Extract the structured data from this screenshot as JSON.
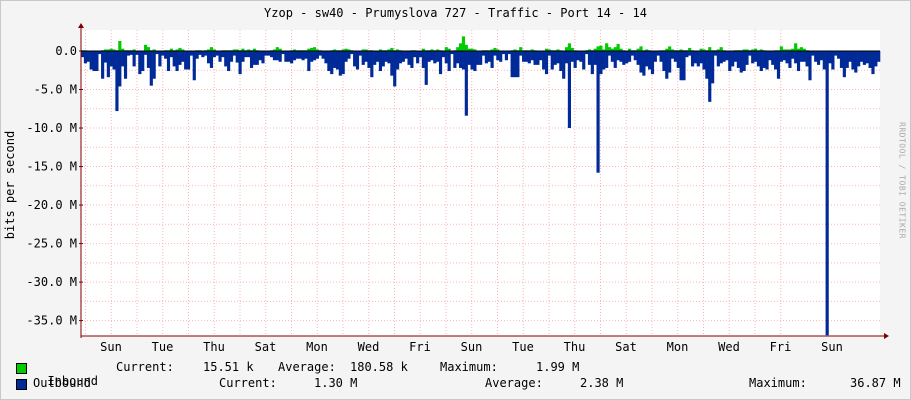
{
  "title": "Yzop - sw40 - Prumyslova 727 - Traffic - Port 14 - 14",
  "vendor_text": "RRDTOOL / TOBI OETIKER",
  "colors": {
    "inbound": "#00cc00",
    "outbound": "#002a97",
    "grid": "#ffb4b4",
    "axis": "#800000",
    "background": "#ffffff"
  },
  "chart_data": {
    "type": "area",
    "ylabel": "bits per second",
    "ylim": [
      -37000000,
      2500000
    ],
    "yticks": [
      0,
      -5000000,
      -10000000,
      -15000000,
      -20000000,
      -25000000,
      -30000000,
      -35000000
    ],
    "ytick_labels": [
      "0.0",
      "-5.0 M",
      "-10.0 M",
      "-15.0 M",
      "-20.0 M",
      "-25.0 M",
      "-30.0 M",
      "-35.0 M"
    ],
    "xtick_labels": [
      "Sun",
      "Tue",
      "Thu",
      "Sat",
      "Mon",
      "Wed",
      "Fri",
      "Sun",
      "Tue",
      "Thu",
      "Sat",
      "Mon",
      "Wed",
      "Fri",
      "Sun"
    ],
    "grid": true,
    "series": [
      {
        "name": "Inbound",
        "values_mbps": [
          0.1,
          0.1,
          0,
          0,
          0,
          0,
          0,
          0.1,
          0.2,
          0.2,
          0.3,
          0.2,
          0.1,
          1.3,
          0.3,
          0.1,
          0.1,
          0.1,
          0.2,
          0,
          0,
          0,
          0.8,
          0.5,
          0.1,
          0.2,
          0,
          0,
          0,
          0.1,
          0.1,
          0.3,
          0.1,
          0.2,
          0.4,
          0.2,
          0,
          0,
          0,
          0,
          0.1,
          0.1,
          0,
          0.1,
          0.2,
          0.5,
          0.2,
          0,
          0,
          0.1,
          0.1,
          0.1,
          0.1,
          0.2,
          0.2,
          0.1,
          0.3,
          0.1,
          0.2,
          0.1,
          0.3,
          0.1,
          0,
          0,
          0,
          0,
          0.1,
          0.2,
          0.5,
          0.3,
          0,
          0,
          0,
          0.1,
          0.2,
          0.1,
          0.1,
          0.1,
          0.1,
          0.3,
          0.4,
          0.5,
          0.2,
          0.1,
          0,
          0,
          0,
          0.1,
          0.2,
          0.1,
          0.1,
          0.2,
          0.3,
          0.2,
          0.1,
          0,
          0,
          0,
          0.2,
          0.2,
          0.1,
          0.1,
          0,
          0,
          0.2,
          0.1,
          0.1,
          0.2,
          0.4,
          0.1,
          0.2,
          0.1,
          0,
          0,
          0,
          0.1,
          0.1,
          0,
          0,
          0.3,
          0.1,
          0.1,
          0.2,
          0.1,
          0.2,
          0.1,
          0,
          0.5,
          0.3,
          0,
          0.1,
          0.5,
          1.0,
          1.9,
          0.8,
          0.3,
          0.3,
          0.2,
          0,
          0,
          0.1,
          0.1,
          0.1,
          0.2,
          0.4,
          0.2,
          0,
          0,
          0,
          0,
          0.1,
          0.2,
          0.1,
          0.5,
          0.1,
          0.1,
          0.1,
          0.2,
          0.1,
          0,
          0,
          0,
          0.3,
          0.2,
          0.1,
          0.1,
          0.2,
          0.1,
          0,
          0.5,
          1.0,
          0.4,
          0.1,
          0,
          0,
          0,
          0.1,
          0.2,
          0.1,
          0.3,
          0.6,
          0.7,
          0.2,
          1.0,
          0.5,
          0.3,
          0.5,
          0.9,
          0.3,
          0.1,
          0,
          0.3,
          0.1,
          0.1,
          0.3,
          0.6,
          0.1,
          0.2,
          0.1,
          0,
          0,
          0,
          0.1,
          0.1,
          0.3,
          0.6,
          0.2,
          0.1,
          0.1,
          0.2,
          0.1,
          0.1,
          0.4,
          0.1,
          0,
          0,
          0.3,
          0.2,
          0.1,
          0.5,
          0.1,
          0.1,
          0.2,
          0.5,
          0.1,
          0,
          0,
          0,
          0.1,
          0.1,
          0.1,
          0.2,
          0.2,
          0.1,
          0.2,
          0.3,
          0.1,
          0.2,
          0.1,
          0,
          0,
          0,
          0.1,
          0.1,
          0.6,
          0.2,
          0.2,
          0.2,
          0.3,
          1.0,
          0.3,
          0.5,
          0.3,
          0.1,
          0,
          0
        ]
      },
      {
        "name": "Outbound",
        "values_mbps": [
          -0.8,
          -1.6,
          -1.4,
          -2.4,
          -2.6,
          -2.6,
          -0.4,
          -3.6,
          -1.5,
          -3.4,
          -2.0,
          -2.4,
          -7.8,
          -4.6,
          -2.0,
          -3.6,
          -0.6,
          -0.5,
          -2.0,
          -0.5,
          -3.0,
          -2.6,
          -0.5,
          -2.2,
          -4.5,
          -3.6,
          -0.4,
          -2.0,
          -0.6,
          -1.0,
          -2.6,
          -0.8,
          -2.0,
          -2.6,
          -1.8,
          -1.4,
          -2.4,
          -2.4,
          -0.6,
          -3.8,
          -1.0,
          -0.5,
          -0.8,
          -0.6,
          -1.6,
          -2.2,
          -0.8,
          -0.6,
          -1.4,
          -0.8,
          -2.0,
          -2.6,
          -1.4,
          -0.6,
          -1.5,
          -3.0,
          -1.4,
          -0.8,
          -0.8,
          -2.2,
          -1.8,
          -1.8,
          -1.2,
          -1.6,
          -0.6,
          -0.6,
          -0.8,
          -1.2,
          -1.2,
          -1.4,
          -0.4,
          -1.4,
          -1.4,
          -1.6,
          -1.2,
          -1.0,
          -1.0,
          -1.2,
          -1.0,
          -2.6,
          -1.4,
          -1.2,
          -1.0,
          -0.6,
          -1.0,
          -1.6,
          -2.6,
          -3.0,
          -2.2,
          -2.4,
          -3.2,
          -3.0,
          -1.4,
          -1.0,
          -0.4,
          -2.0,
          -2.4,
          -0.6,
          -1.8,
          -1.4,
          -2.2,
          -3.4,
          -1.8,
          -1.4,
          -2.6,
          -2.0,
          -1.4,
          -1.6,
          -3.2,
          -4.6,
          -2.4,
          -1.6,
          -1.4,
          -1.0,
          -1.8,
          -2.2,
          -0.8,
          -1.6,
          -0.8,
          -2.2,
          -4.4,
          -1.4,
          -1.2,
          -1.6,
          -1.4,
          -3.0,
          -0.8,
          -1.6,
          -2.6,
          -0.4,
          -2.2,
          -1.6,
          -2.2,
          -2.4,
          -8.4,
          -1.8,
          -2.4,
          -2.6,
          -1.8,
          -1.8,
          -0.6,
          -1.6,
          -1.4,
          -2.2,
          -0.6,
          -1.2,
          -1.4,
          -0.4,
          -1.2,
          -0.4,
          -3.4,
          -3.4,
          -3.4,
          -0.6,
          -1.4,
          -1.4,
          -1.6,
          -1.2,
          -1.8,
          -1.8,
          -1.2,
          -2.4,
          -3.0,
          -0.6,
          -2.4,
          -1.8,
          -1.6,
          -2.6,
          -3.6,
          -1.6,
          -10.0,
          -1.4,
          -2.2,
          -1.2,
          -1.4,
          -2.4,
          -0.4,
          -1.8,
          -3.0,
          -1.8,
          -15.8,
          -3.0,
          -2.4,
          -2.2,
          -0.6,
          -1.4,
          -2.2,
          -1.2,
          -1.4,
          -1.8,
          -1.6,
          -1.4,
          -0.6,
          -1.2,
          -1.8,
          -2.8,
          -3.2,
          -2.0,
          -2.4,
          -3.0,
          -1.4,
          -0.6,
          -1.4,
          -2.6,
          -3.6,
          -2.8,
          -1.0,
          -1.4,
          -2.2,
          -3.8,
          -3.8,
          -0.8,
          -0.6,
          -2.0,
          -1.6,
          -2.0,
          -1.6,
          -2.4,
          -3.6,
          -6.6,
          -4.2,
          -0.6,
          -2.0,
          -1.6,
          -1.4,
          -1.2,
          -2.6,
          -2.0,
          -1.4,
          -2.2,
          -2.8,
          -2.6,
          -1.8,
          -0.6,
          -1.6,
          -1.4,
          -2.0,
          -2.6,
          -2.2,
          -2.4,
          -1.2,
          -1.8,
          -2.4,
          -3.6,
          -1.4,
          -1.2,
          -1.6,
          -2.2,
          -1.0,
          -1.6,
          -2.6,
          -1.4,
          -1.4,
          -2.0,
          -3.8,
          -0.6,
          -1.4,
          -1.8,
          -1.2,
          -2.4,
          -36.9,
          -1.6,
          -2.4,
          -0.6,
          -1.0,
          -2.2,
          -3.4,
          -2.2,
          -1.4,
          -2.4,
          -2.8,
          -2.0,
          -1.4,
          -1.8,
          -1.6,
          -2.2,
          -3.0,
          -2.0,
          -1.4
        ]
      }
    ]
  },
  "legend": {
    "inbound": {
      "label": "Inbound",
      "current_label": "Current:",
      "current": "15.51 k",
      "average_label": "Average:",
      "average": "180.58 k",
      "maximum_label": "Maximum:",
      "maximum": "1.99 M"
    },
    "outbound": {
      "label": "Outbound",
      "current_label": "Current:",
      "current": "1.30 M",
      "average_label": "Average:",
      "average": "2.38 M",
      "maximum_label": "Maximum:",
      "maximum": "36.87 M"
    }
  }
}
